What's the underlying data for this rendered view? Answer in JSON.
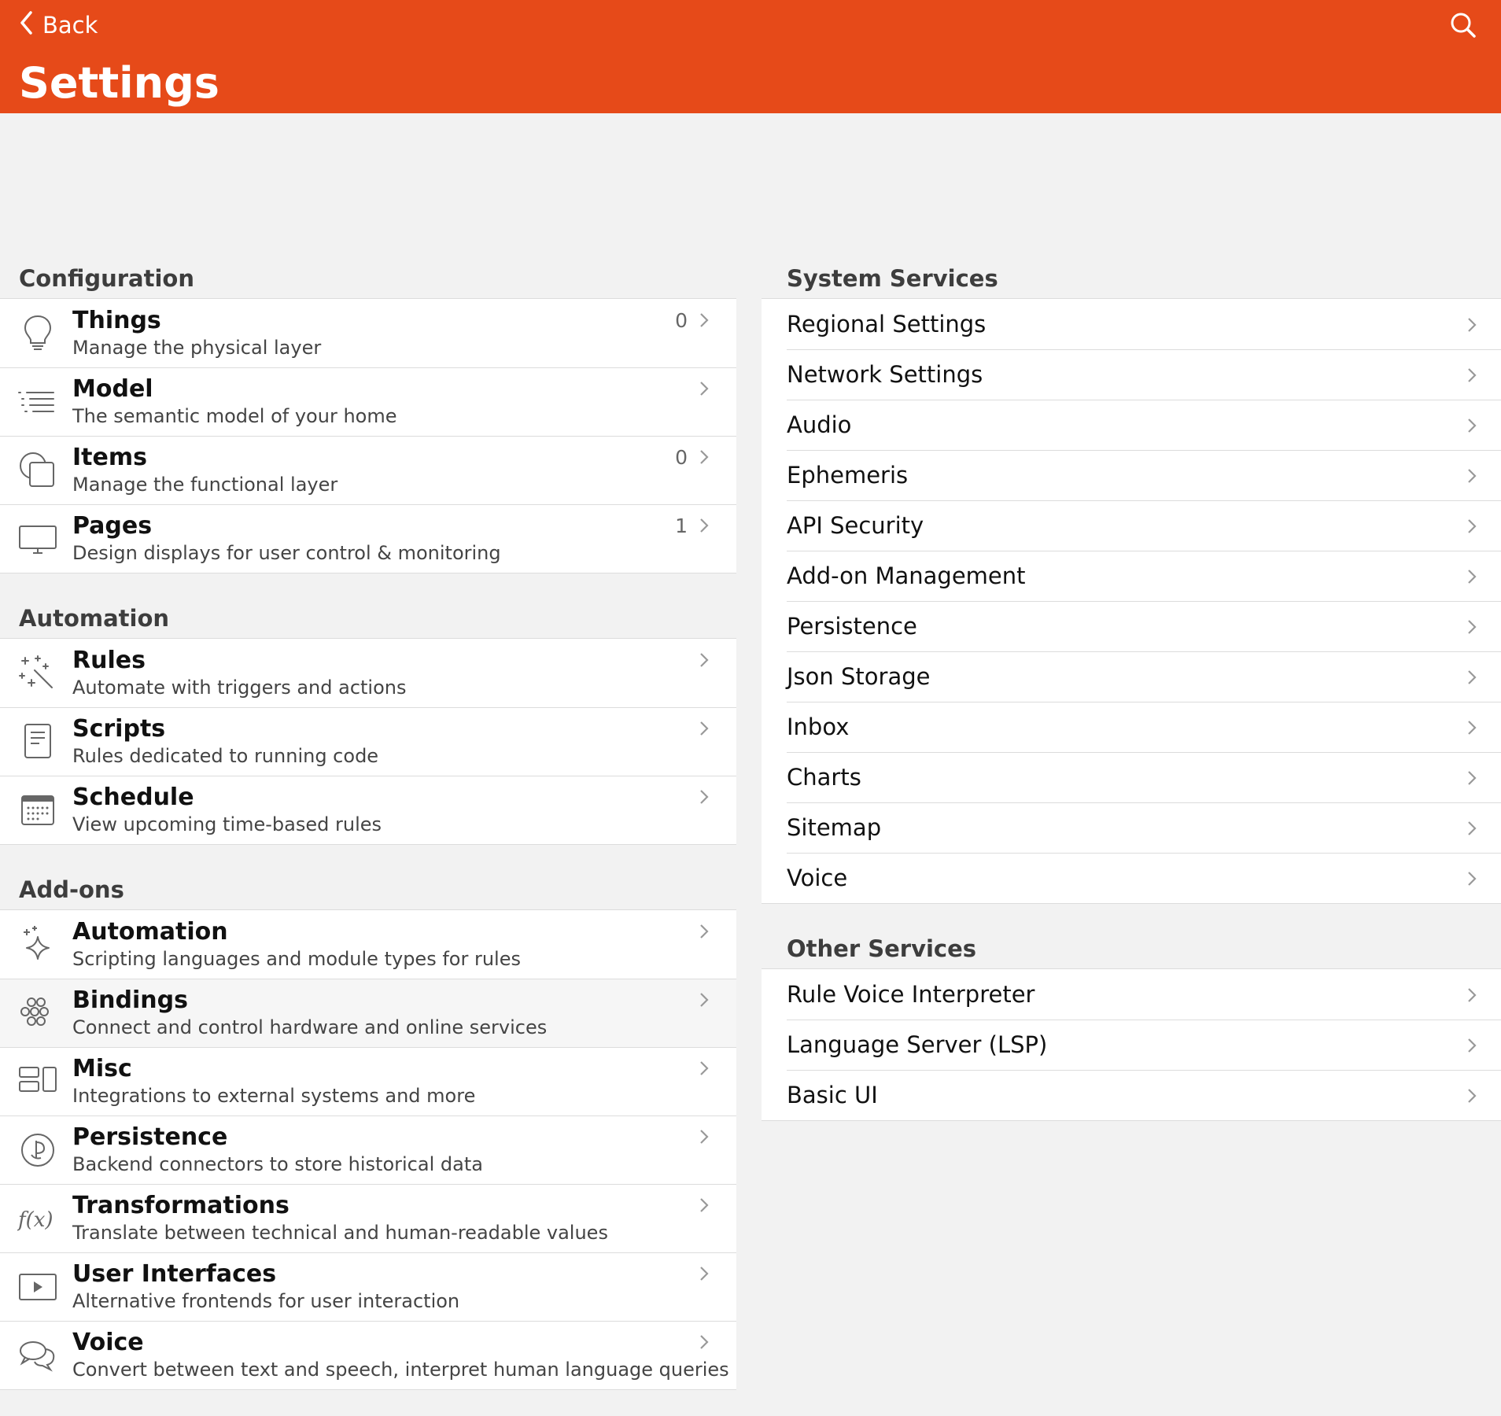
{
  "header": {
    "back_label": "Back",
    "title": "Settings",
    "bg_color": "#e64a19"
  },
  "configuration": {
    "title": "Configuration",
    "items": [
      {
        "title": "Things",
        "subtitle": "Manage the physical layer",
        "badge": "0",
        "icon": "lightbulb-icon"
      },
      {
        "title": "Model",
        "subtitle": "The semantic model of your home",
        "badge": "",
        "icon": "list-indent-icon"
      },
      {
        "title": "Items",
        "subtitle": "Manage the functional layer",
        "badge": "0",
        "icon": "square-circle-icon"
      },
      {
        "title": "Pages",
        "subtitle": "Design displays for user control & monitoring",
        "badge": "1",
        "icon": "display-icon"
      }
    ]
  },
  "automation": {
    "title": "Automation",
    "items": [
      {
        "title": "Rules",
        "subtitle": "Automate with triggers and actions",
        "icon": "magic-wand-icon"
      },
      {
        "title": "Scripts",
        "subtitle": "Rules dedicated to running code",
        "icon": "document-icon"
      },
      {
        "title": "Schedule",
        "subtitle": "View upcoming time-based rules",
        "icon": "calendar-icon"
      }
    ]
  },
  "addons": {
    "title": "Add-ons",
    "items": [
      {
        "title": "Automation",
        "subtitle": "Scripting languages and module types for rules",
        "icon": "sparkle-icon"
      },
      {
        "title": "Bindings",
        "subtitle": "Connect and control hardware and online services",
        "icon": "circles-grid-icon"
      },
      {
        "title": "Misc",
        "subtitle": "Integrations to external systems and more",
        "icon": "rectangles-icon"
      },
      {
        "title": "Persistence",
        "subtitle": "Backend connectors to store historical data",
        "icon": "persistence-icon"
      },
      {
        "title": "Transformations",
        "subtitle": "Translate between technical and human-readable values",
        "icon": "function-icon"
      },
      {
        "title": "User Interfaces",
        "subtitle": "Alternative frontends for user interaction",
        "icon": "play-rectangle-icon"
      },
      {
        "title": "Voice",
        "subtitle": "Convert between text and speech, interpret human language queries",
        "icon": "speech-bubbles-icon"
      }
    ]
  },
  "system_services": {
    "title": "System Services",
    "items": [
      "Regional Settings",
      "Network Settings",
      "Audio",
      "Ephemeris",
      "API Security",
      "Add-on Management",
      "Persistence",
      "Json Storage",
      "Inbox",
      "Charts",
      "Sitemap",
      "Voice"
    ]
  },
  "other_services": {
    "title": "Other Services",
    "items": [
      "Rule Voice Interpreter",
      "Language Server (LSP)",
      "Basic UI"
    ]
  }
}
